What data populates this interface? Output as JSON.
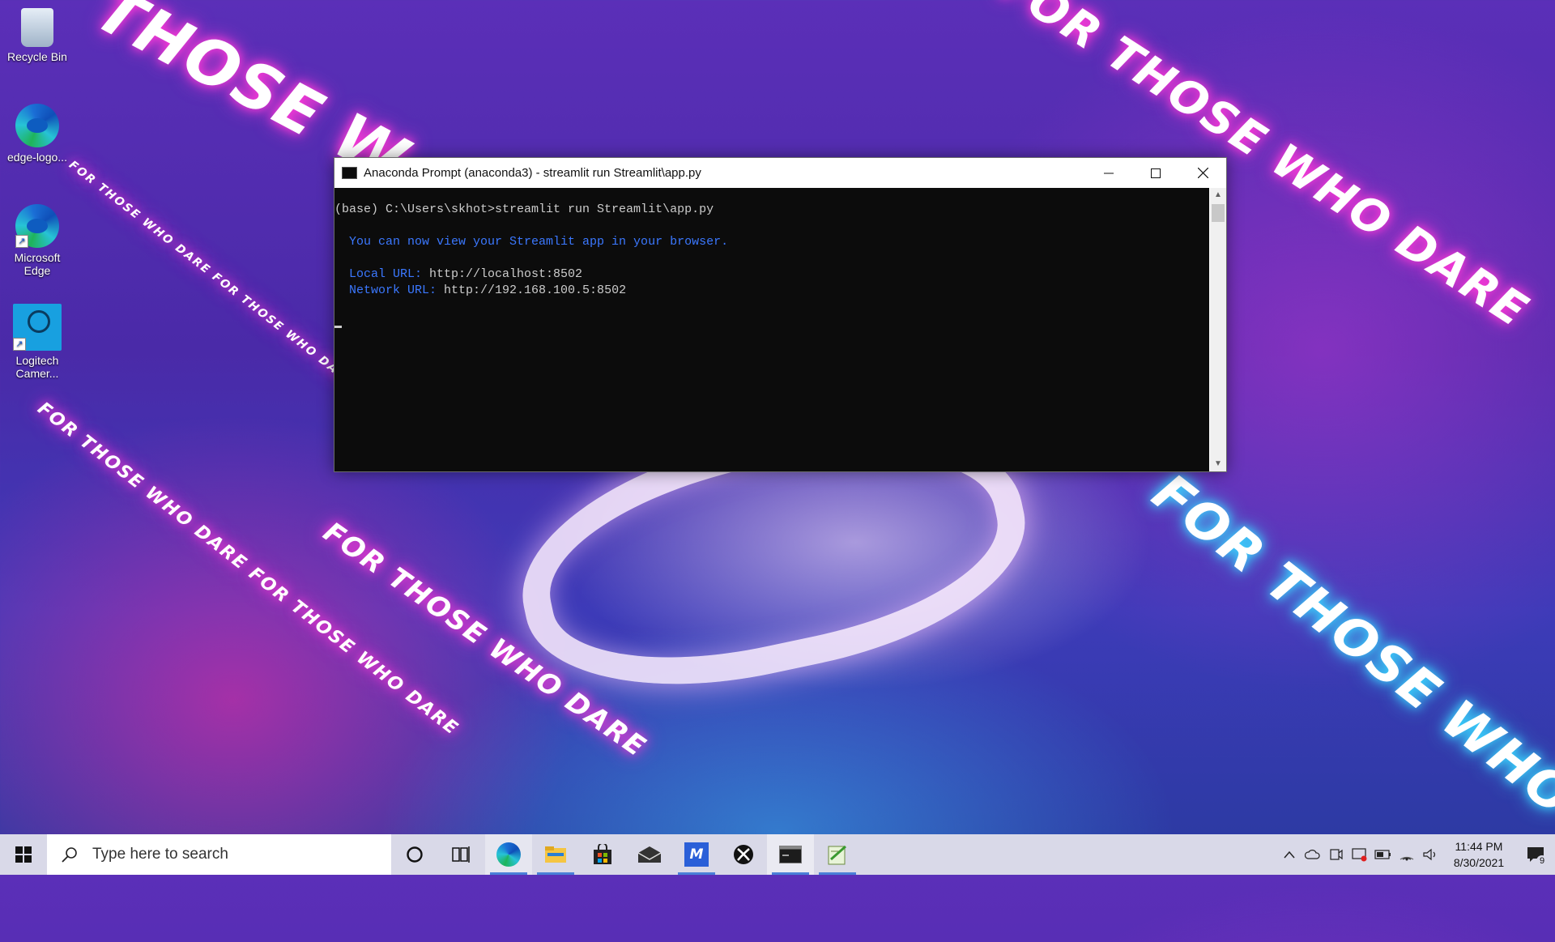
{
  "wallpaper": {
    "slogan": "FOR THOSE WHO DARE",
    "slogan_short": "THOSE W",
    "slogan_repeat": "FOR THOSE WHO DARE FOR THOSE WHO DARE"
  },
  "desktop_icons": [
    {
      "label": "Recycle Bin",
      "icon": "recycle-bin-icon"
    },
    {
      "label": "edge-logo...",
      "icon": "edge-icon"
    },
    {
      "label": "Microsoft Edge",
      "icon": "edge-icon"
    },
    {
      "label": "Logitech Camer...",
      "icon": "logitech-camera-icon"
    }
  ],
  "window": {
    "title": "Anaconda Prompt (anaconda3) - streamlit  run Streamlit\\app.py",
    "console": {
      "command_line": "(base) C:\\Users\\skhot>streamlit run Streamlit\\app.py",
      "info": "  You can now view your Streamlit app in your browser.",
      "local_label": "  Local URL: ",
      "local_url": "http://localhost:8502",
      "network_label": "  Network URL: ",
      "network_url": "http://192.168.100.5:8502"
    }
  },
  "taskbar": {
    "search_placeholder": "Type here to search",
    "apps": [
      "edge-icon",
      "file-explorer-icon",
      "store-icon",
      "mail-icon",
      "autodesk-icon",
      "xbox-icon",
      "terminal-icon",
      "notepad-icon"
    ],
    "clock_time": "11:44 PM",
    "clock_date": "8/30/2021",
    "notification_count": "9"
  }
}
